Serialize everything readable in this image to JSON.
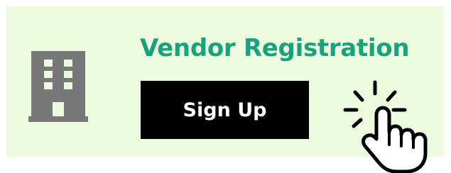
{
  "banner": {
    "title": "Vendor Registration",
    "button_label": "Sign Up"
  },
  "icons": {
    "building": "building-icon",
    "cursor": "hand-pointer-click-icon"
  },
  "colors": {
    "background": "#ecfade",
    "title": "#18a27e",
    "button_background": "#000000",
    "button_text": "#ffffff",
    "icon": "#777777"
  }
}
